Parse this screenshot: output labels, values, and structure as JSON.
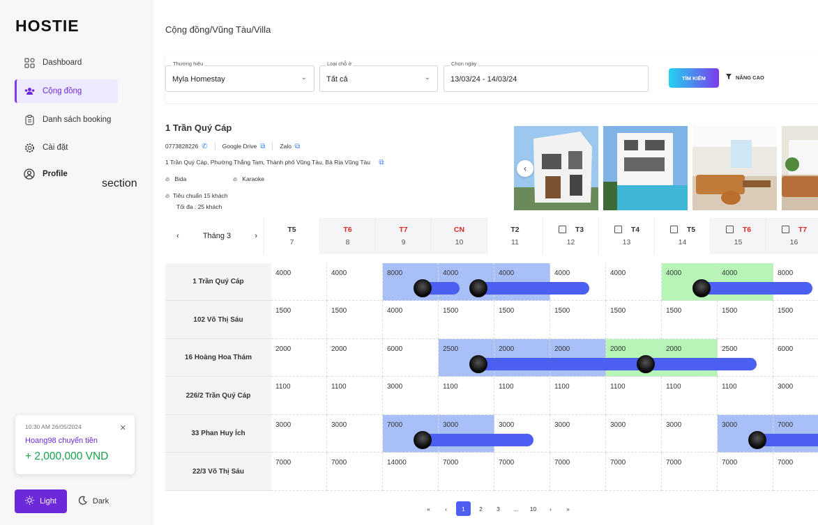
{
  "brand": {
    "logo": "HOSTIE"
  },
  "sidebar": {
    "items": [
      {
        "label": "Dashboard",
        "icon": "grid-icon"
      },
      {
        "label": "Cộng đồng",
        "icon": "community-icon"
      },
      {
        "label": "Danh sách booking",
        "icon": "clipboard-icon"
      },
      {
        "label": "Cài đặt",
        "icon": "gear-icon"
      },
      {
        "label": "Profile",
        "icon": "user-circle-icon"
      }
    ],
    "section_label": "section"
  },
  "toast": {
    "time": "10:30 AM  26/05/2024",
    "user_action": "Hoang98 chuyển tiền",
    "amount": "+ 2,000,000 VND"
  },
  "theme": {
    "light": "Light",
    "dark": "Dark"
  },
  "breadcrumb": "Cộng đồng/Vũng Tàu/Villa",
  "filters": {
    "brand": {
      "label": "Thương hiệu",
      "value": "Myla Homestay"
    },
    "type": {
      "label": "Loại chỗ ở",
      "value": "Tất cả"
    },
    "date": {
      "label": "Chọn ngày",
      "value": "13/03/24 - 14/03/24"
    },
    "search_label": "TÌM KIẾM",
    "advanced_label": "NÂNG CAO"
  },
  "property": {
    "name": "1 Trần Quý Cáp",
    "phone": "0773828226",
    "drive": "Google Drive",
    "zalo": "Zalo",
    "address": "1 Trần Quý Cáp, Phường Thắng Tam, Thành phố Vũng Tàu, Bà Rịa Vũng Tàu",
    "amenities": [
      "Bida",
      "Karaoke"
    ],
    "capacity_standard": "Tiêu chuẩn 15 khách",
    "capacity_max": "Tối đa : 25 khách"
  },
  "calendar": {
    "month": "Tháng 3",
    "days": [
      {
        "dow": "T5",
        "date": "7",
        "red": false,
        "chk": false,
        "shaded": false
      },
      {
        "dow": "T6",
        "date": "8",
        "red": true,
        "chk": false,
        "shaded": true
      },
      {
        "dow": "T7",
        "date": "9",
        "red": true,
        "chk": false,
        "shaded": true
      },
      {
        "dow": "CN",
        "date": "10",
        "red": true,
        "chk": false,
        "shaded": true
      },
      {
        "dow": "T2",
        "date": "11",
        "red": false,
        "chk": false,
        "shaded": false
      },
      {
        "dow": "T3",
        "date": "12",
        "red": false,
        "chk": true,
        "shaded": false
      },
      {
        "dow": "T4",
        "date": "13",
        "red": false,
        "chk": true,
        "shaded": false
      },
      {
        "dow": "T5",
        "date": "14",
        "red": false,
        "chk": true,
        "shaded": false
      },
      {
        "dow": "T6",
        "date": "15",
        "red": true,
        "chk": true,
        "shaded": true
      },
      {
        "dow": "T7",
        "date": "16",
        "red": true,
        "chk": true,
        "shaded": true
      }
    ],
    "rows": [
      {
        "name": "1 Trần Quý Cáp",
        "prices": [
          "4000",
          "4000",
          "8000",
          "4000",
          "4000",
          "4000",
          "4000",
          "4000",
          "4000",
          "8000"
        ],
        "fills": [
          "",
          "",
          "blue",
          "blue",
          "blue",
          "",
          "",
          "green",
          "green",
          ""
        ]
      },
      {
        "name": "102 Võ Thị Sáu",
        "prices": [
          "1500",
          "1500",
          "4000",
          "1500",
          "1500",
          "1500",
          "1500",
          "1500",
          "1500",
          "1500"
        ],
        "fills": [
          "",
          "",
          "",
          "",
          "",
          "",
          "",
          "",
          "",
          ""
        ]
      },
      {
        "name": "16 Hoàng Hoa Thám",
        "prices": [
          "2000",
          "2000",
          "6000",
          "2500",
          "2000",
          "2000",
          "2000",
          "2000",
          "2500",
          "6000"
        ],
        "fills": [
          "",
          "",
          "",
          "blue",
          "blue",
          "blue",
          "green",
          "green",
          "",
          ""
        ]
      },
      {
        "name": "226/2 Trần Quý Cáp",
        "prices": [
          "1100",
          "1100",
          "3000",
          "1100",
          "1100",
          "1100",
          "1100",
          "1100",
          "1100",
          "3000"
        ],
        "fills": [
          "",
          "",
          "",
          "",
          "",
          "",
          "",
          "",
          "",
          ""
        ]
      },
      {
        "name": "33 Phan Huy Ích",
        "prices": [
          "3000",
          "3000",
          "7000",
          "3000",
          "3000",
          "3000",
          "3000",
          "3000",
          "3000",
          "7000"
        ],
        "fills": [
          "",
          "",
          "blue",
          "blue",
          "",
          "",
          "",
          "",
          "blue",
          "blue"
        ]
      },
      {
        "name": "22/3 Võ Thị Sáu",
        "prices": [
          "7000",
          "7000",
          "14000",
          "7000",
          "7000",
          "7000",
          "7000",
          "7000",
          "7000",
          "7000"
        ],
        "fills": [
          "",
          "",
          "",
          "",
          "",
          "",
          "",
          "",
          "",
          ""
        ]
      }
    ]
  },
  "pagination": [
    "«",
    "‹",
    "1",
    "2",
    "3",
    "...",
    "10",
    "›",
    "»"
  ],
  "colors": {
    "accent": "#6d28d9",
    "booking_blue": "#a9bff7",
    "booking_green": "#b6f5b6",
    "bar": "#4b5ff0"
  }
}
